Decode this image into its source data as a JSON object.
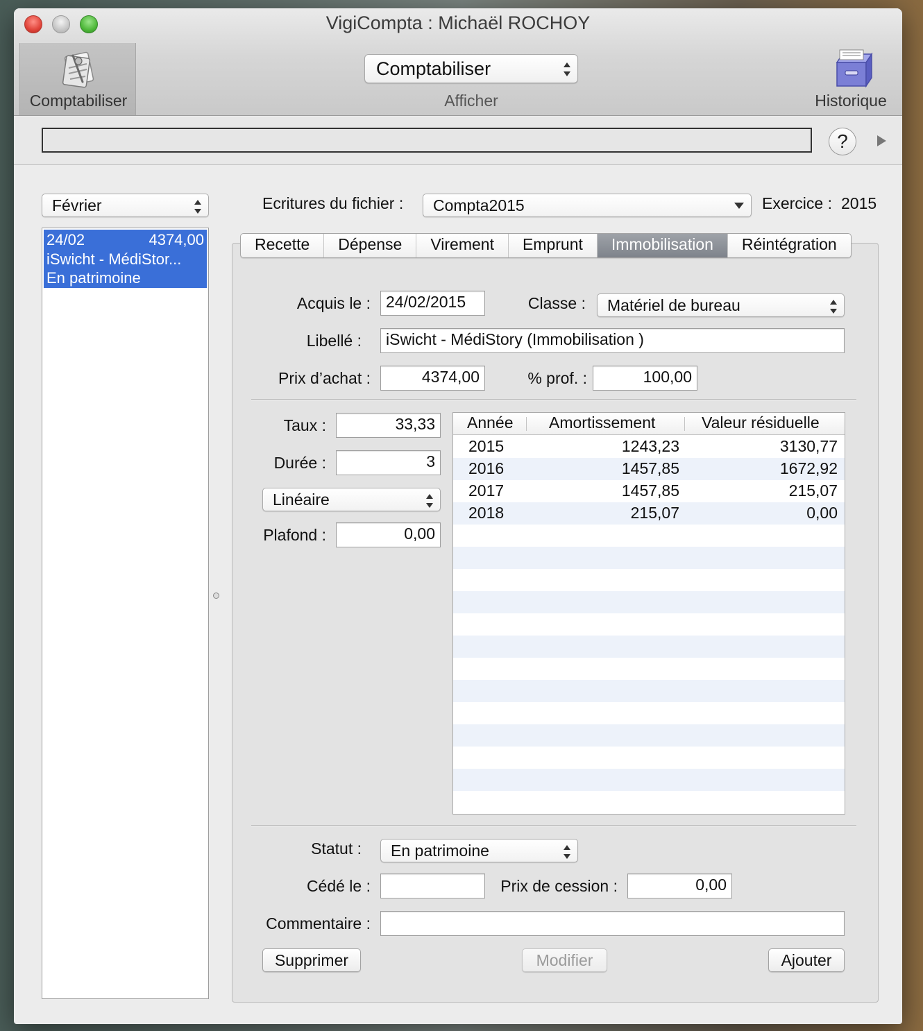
{
  "window": {
    "title": "VigiCompta : Michaël ROCHOY"
  },
  "toolbar": {
    "left_label": "Comptabiliser",
    "mode_popup_value": "Comptabiliser",
    "mode_popup_caption": "Afficher",
    "right_label": "Historique",
    "left_icon": "comptabiliser-icon",
    "right_icon": "historique-icon"
  },
  "statusbar": {
    "help_label": "?"
  },
  "sidebar": {
    "month_popup": "Février",
    "entries": [
      {
        "date": "24/02",
        "amount": "4374,00",
        "label": "iSwicht - MédiStor...",
        "status": "En patrimoine",
        "selected": true
      }
    ]
  },
  "header": {
    "file_label": "Ecritures du fichier :",
    "file_value": "Compta2015",
    "exercice_label": "Exercice :",
    "exercice_value": "2015"
  },
  "tabs": [
    {
      "label": "Recette",
      "active": false
    },
    {
      "label": "Dépense",
      "active": false
    },
    {
      "label": "Virement",
      "active": false
    },
    {
      "label": "Emprunt",
      "active": false
    },
    {
      "label": "Immobilisation",
      "active": true
    },
    {
      "label": "Réintégration",
      "active": false
    }
  ],
  "form": {
    "acquis_label": "Acquis le :",
    "acquis_value": "24/02/2015",
    "classe_label": "Classe :",
    "classe_value": "Matériel de bureau",
    "libelle_label": "Libellé :",
    "libelle_value": "iSwicht - MédiStory (Immobilisation )",
    "prix_label": "Prix d’achat :",
    "prix_value": "4374,00",
    "prof_label": "% prof. :",
    "prof_value": "100,00",
    "taux_label": "Taux :",
    "taux_value": "33,33",
    "duree_label": "Durée :",
    "duree_value": "3",
    "methode_value": "Linéaire",
    "plafond_label": "Plafond :",
    "plafond_value": "0,00",
    "statut_label": "Statut :",
    "statut_value": "En patrimoine",
    "cede_label": "Cédé le :",
    "cede_value": "",
    "cession_label": "Prix de cession :",
    "cession_value": "0,00",
    "commentaire_label": "Commentaire :",
    "commentaire_value": ""
  },
  "table": {
    "headers": [
      "Année",
      "Amortissement",
      "Valeur résiduelle"
    ],
    "rows": [
      [
        "2015",
        "1243,23",
        "3130,77"
      ],
      [
        "2016",
        "1457,85",
        "1672,92"
      ],
      [
        "2017",
        "1457,85",
        "215,07"
      ],
      [
        "2018",
        "215,07",
        "0,00"
      ]
    ]
  },
  "buttons": {
    "supprimer": "Supprimer",
    "modifier": "Modifier",
    "ajouter": "Ajouter"
  },
  "colors": {
    "selection": "#3a6fd8",
    "active_tab": "#868b92",
    "row_alt": "#edf2fa"
  }
}
